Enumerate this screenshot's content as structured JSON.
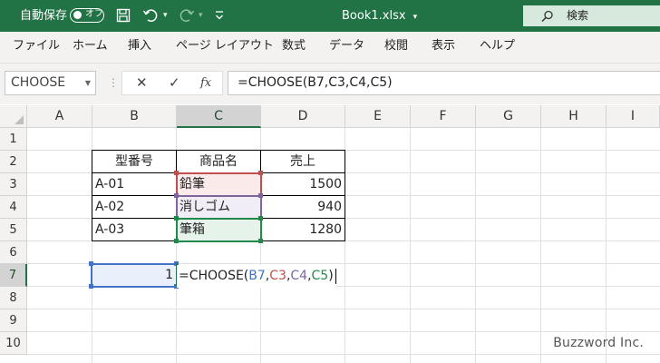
{
  "colors": {
    "excel_green": "#217346",
    "ref_b7": "#4472c4",
    "ref_c3": "#c0504d",
    "ref_c4": "#8064a2",
    "ref_c5": "#218a4a"
  },
  "titlebar": {
    "autosave_label": "自動保存",
    "toggle_state": "オフ",
    "save_icon": "save-icon",
    "undo_icon": "undo-icon",
    "redo_icon": "redo-icon",
    "customize_icon": "customize-icon",
    "filename": "Book1.xlsx",
    "filename_dropdown": "▾",
    "search_placeholder": "検索"
  },
  "ribbon": {
    "tabs": [
      "ファイル",
      "ホーム",
      "挿入",
      "ページ レイアウト",
      "数式",
      "データ",
      "校閲",
      "表示",
      "ヘルプ"
    ]
  },
  "formula_bar": {
    "name_box": "CHOOSE",
    "cancel_icon": "✕",
    "enter_icon": "✓",
    "fx_icon": "fx",
    "formula": "=CHOOSE(B7,C3,C4,C5)"
  },
  "grid": {
    "columns": [
      "A",
      "B",
      "C",
      "D",
      "E",
      "F",
      "G",
      "H",
      "I"
    ],
    "rows": [
      "1",
      "2",
      "3",
      "4",
      "5",
      "6",
      "7",
      "8",
      "9",
      "10"
    ],
    "selected_column": "C",
    "selected_row": "7"
  },
  "table": {
    "headers": [
      "型番号",
      "商品名",
      "売上"
    ],
    "rows": [
      [
        "A-01",
        "鉛筆",
        "1500"
      ],
      [
        "A-02",
        "消しゴム",
        "940"
      ],
      [
        "A-03",
        "筆箱",
        "1280"
      ]
    ]
  },
  "cell_b7": "1",
  "edit_formula": {
    "prefix": "=CHOOSE(",
    "arg1": "B7",
    "comma1": ",",
    "arg2": "C3",
    "comma2": ",",
    "arg3": "C4",
    "comma3": ",",
    "arg4": "C5",
    "suffix": ")"
  },
  "watermark": "Buzzword Inc."
}
